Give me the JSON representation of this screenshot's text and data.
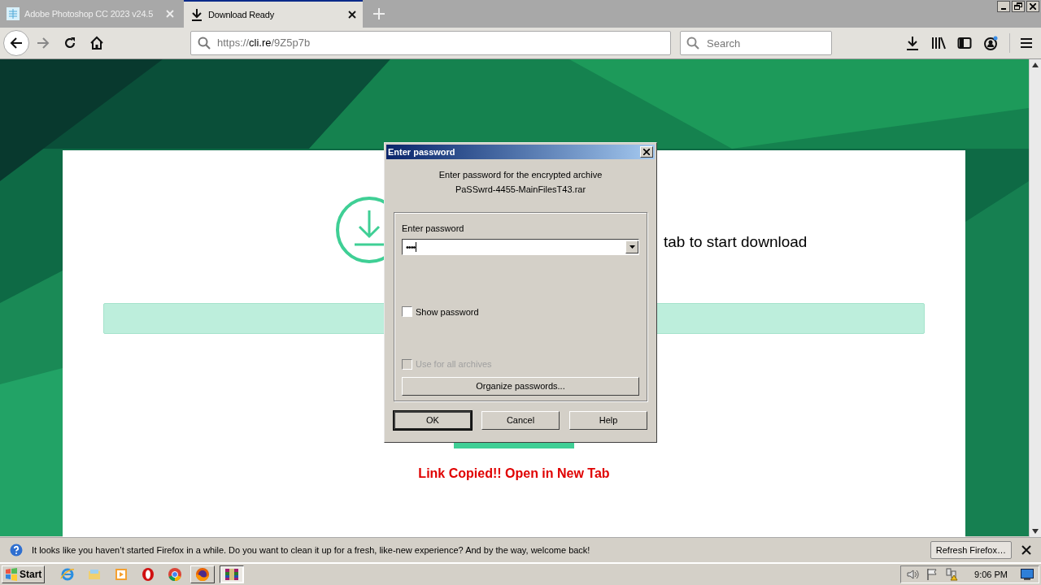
{
  "browser": {
    "tabs": [
      {
        "title": "Adobe Photoshop CC 2023 v24.5",
        "selected": false,
        "kind": "site"
      },
      {
        "title": "Download Ready",
        "selected": true,
        "kind": "download"
      }
    ],
    "url": {
      "scheme": "https://",
      "host": "cli.re",
      "path": "/9Z5p7b"
    },
    "search": {
      "placeholder": "Search"
    }
  },
  "page": {
    "heading": "tab to start download",
    "notice": "Link Copied!! Open in New Tab"
  },
  "dialog": {
    "title": "Enter password",
    "message": [
      "Enter password for the encrypted archive",
      "PaSSwrd-4455-MainFilesT43.rar"
    ],
    "field_label": "Enter password",
    "password": "••••",
    "checkboxes": [
      {
        "label": "Show password",
        "checked": false,
        "disabled": false
      },
      {
        "label": "Use for all archives",
        "checked": false,
        "disabled": true
      }
    ],
    "organize_button": "Organize passwords...",
    "buttons": [
      {
        "label": "OK",
        "default": true
      },
      {
        "label": "Cancel",
        "default": false
      },
      {
        "label": "Help",
        "default": false
      }
    ]
  },
  "notification": {
    "text": "It looks like you haven’t started Firefox in a while. Do you want to clean it up for a fresh, like-new experience? And by the way, welcome back!",
    "button": "Refresh Firefox…"
  },
  "taskbar": {
    "start": "Start",
    "apps": [
      {
        "kind": "ie",
        "open": false,
        "selected": false
      },
      {
        "kind": "explorer",
        "open": false,
        "selected": false
      },
      {
        "kind": "media",
        "open": false,
        "selected": false
      },
      {
        "kind": "opera",
        "open": false,
        "selected": false
      },
      {
        "kind": "chrome",
        "open": false,
        "selected": false
      },
      {
        "kind": "firefox",
        "open": true,
        "selected": false
      },
      {
        "kind": "winrar",
        "open": true,
        "selected": true
      }
    ],
    "clock": "9:06 PM"
  }
}
